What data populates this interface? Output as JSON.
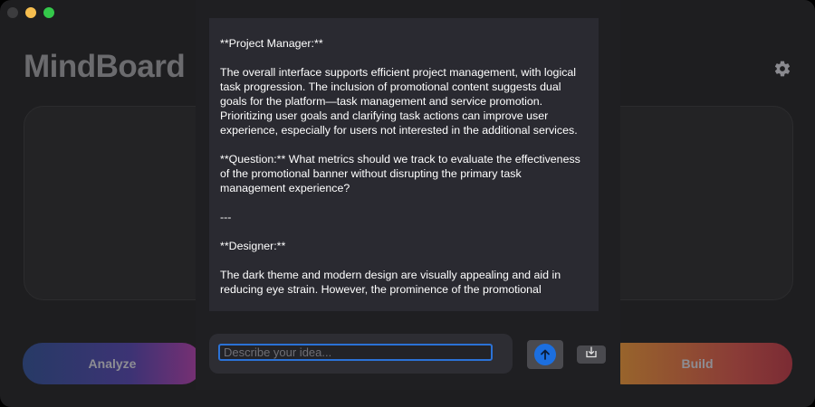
{
  "app": {
    "title": "MindBoard"
  },
  "buttons": {
    "analyze": "Analyze",
    "build": "Build"
  },
  "chat": {
    "messages": [
      "**Project Manager:**",
      "The overall interface supports efficient project management, with logical task progression. The inclusion of promotional content suggests dual goals for the platform—task management and service promotion. Prioritizing user goals and clarifying task actions can improve user experience, especially for users not interested in the additional services.",
      "**Question:** What metrics should we track to evaluate the effectiveness of the promotional banner without disrupting the primary task management experience?",
      "---",
      "**Designer:**",
      "The dark theme and modern design are visually appealing and aid in reducing eye strain. However, the prominence of the promotional"
    ],
    "input_placeholder": "Describe your idea...",
    "input_value": ""
  },
  "icons": {
    "settings": "gear-icon",
    "send": "arrow-up-icon",
    "save": "download-tray-icon"
  },
  "colors": {
    "accent": "#1c6fe0",
    "panel_bg": "#2a2a31",
    "window_bg": "#1e1e20"
  }
}
